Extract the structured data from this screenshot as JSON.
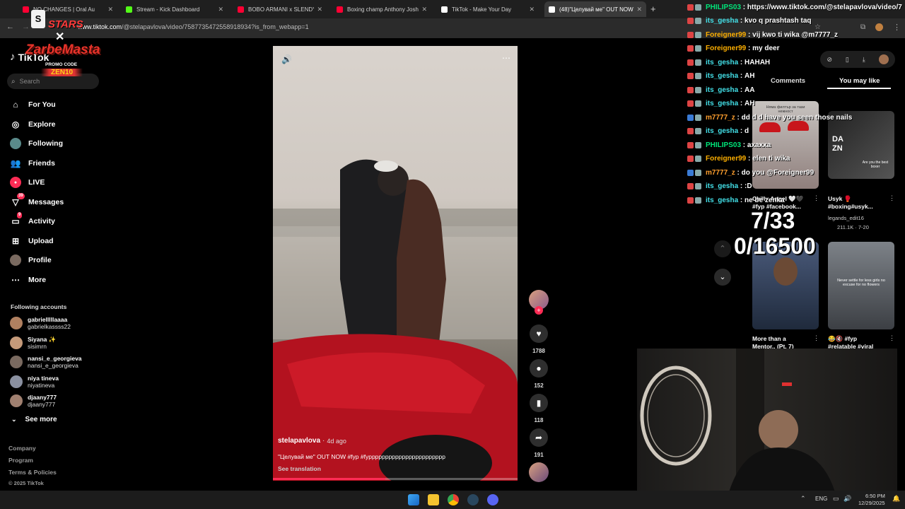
{
  "browser": {
    "tabs": [
      {
        "label": "NO CHANGES | Oral Au",
        "icon_color": "#ff0033",
        "active": false
      },
      {
        "label": "Stream - Kick Dashboard",
        "icon_color": "#53fc18",
        "active": false
      },
      {
        "label": "BOBO ARMANI x SLENDY x PAN",
        "icon_color": "#ff0033",
        "active": false
      },
      {
        "label": "Boxing champ Anthony Joshua",
        "icon_color": "#ff0033",
        "active": false
      },
      {
        "label": "TikTok - Make Your Day",
        "icon_color": "#ffffff",
        "active": false
      },
      {
        "label": "(48)\"Целувай ме\" OUT NOW",
        "icon_color": "#ffffff",
        "active": true
      }
    ],
    "new_tab_icon": "plus-icon",
    "url_host": "www.tiktok.com",
    "url_path": "/@stelapavlova/video/7587735472558918934?is_from_webapp=1"
  },
  "overlay": {
    "brand_top": "STARS",
    "brand_main": "ZarbeMasta",
    "promo_label": "PROMO CODE",
    "promo_code": "ZEN10",
    "counter_top": "7/33",
    "counter_bottom": "0/16500"
  },
  "tiktok": {
    "logo": "TikTok",
    "search_placeholder": "Search",
    "nav": [
      {
        "label": "For You",
        "icon": "home-icon",
        "badge": ""
      },
      {
        "label": "Explore",
        "icon": "compass-icon",
        "badge": ""
      },
      {
        "label": "Following",
        "icon": "following-avatar-icon",
        "badge": ""
      },
      {
        "label": "Friends",
        "icon": "friends-icon",
        "badge": ""
      },
      {
        "label": "LIVE",
        "icon": "live-icon",
        "badge": ""
      },
      {
        "label": "Messages",
        "icon": "messages-icon",
        "badge": "39"
      },
      {
        "label": "Activity",
        "icon": "activity-icon",
        "badge": "9"
      },
      {
        "label": "Upload",
        "icon": "upload-icon",
        "badge": ""
      },
      {
        "label": "Profile",
        "icon": "profile-avatar-icon",
        "badge": ""
      },
      {
        "label": "More",
        "icon": "more-dots-icon",
        "badge": ""
      }
    ],
    "following_header": "Following accounts",
    "accounts": [
      {
        "name": "gabrielllllaaaa",
        "handle": "gabrielkassss22",
        "color": "#b08060"
      },
      {
        "name": "Siyana ✨",
        "handle": "sisimrn",
        "color": "#c59a7a"
      },
      {
        "name": "nansi_e_georgieva",
        "handle": "nansi_e_georgieva",
        "color": "#7a6a60"
      },
      {
        "name": "niya tineva",
        "handle": "niyatineva",
        "color": "#8a90a0"
      },
      {
        "name": "djaany777",
        "handle": "djaany777",
        "color": "#a08070"
      }
    ],
    "see_more": "See more",
    "footer": [
      "Company",
      "Program",
      "Terms & Policies",
      "© 2025 TikTok"
    ],
    "video": {
      "author": "stelapavlova",
      "age": "4d ago",
      "caption": "\"Целувай ме\" OUT NOW #fyp #fyppppppppppppppppppppppp",
      "see_translation": "See translation",
      "progress": 0.46
    },
    "actions": [
      {
        "icon": "heart-icon",
        "count": "1788"
      },
      {
        "icon": "comment-icon",
        "count": "152"
      },
      {
        "icon": "bookmark-icon",
        "count": "118"
      },
      {
        "icon": "share-icon",
        "count": "191"
      }
    ],
    "panel_tabs": [
      "Comments",
      "You may like"
    ],
    "suggested": [
      {
        "caption": "Chilly Angel 🤍🖤 #fyp #facebook...",
        "author": "",
        "stats": ""
      },
      {
        "caption": "Usyk 🥊 #boxing#usyk...",
        "author": "legands_edit16",
        "stats": "211.1K · 7-20"
      },
      {
        "caption": "More than a Mentor.. (Pt. 7)",
        "author": "",
        "stats": ""
      },
      {
        "caption": "😂🔇 #fyp #relatable #viral",
        "author": "",
        "stats": ""
      }
    ],
    "thumb_texts": [
      "Няма филтър за тази нежност",
      "DA ZN",
      "Are you the best boxer",
      "Never settle for less girls no excuse for no flowers"
    ]
  },
  "chat": [
    {
      "user": "PHILIPS03",
      "user_color": "#00e67a",
      "message": "https://www.tiktok.com/@stelapavlova/video/7"
    },
    {
      "user": "its_gesha",
      "user_color": "#43e0e8",
      "message": "kvo q prashtash taq"
    },
    {
      "user": "Foreigner99",
      "user_color": "#ffb000",
      "message": "vij kwo ti wika @m7777_z"
    },
    {
      "user": "Foreigner99",
      "user_color": "#ffb000",
      "message": "my deer"
    },
    {
      "user": "its_gesha",
      "user_color": "#43e0e8",
      "message": "HAHAH"
    },
    {
      "user": "its_gesha",
      "user_color": "#43e0e8",
      "message": "AH"
    },
    {
      "user": "its_gesha",
      "user_color": "#43e0e8",
      "message": "AA"
    },
    {
      "user": "its_gesha",
      "user_color": "#43e0e8",
      "message": "AH"
    },
    {
      "user": "m7777_z",
      "user_color": "#ff9f2e",
      "message": "dd d d have you seen those nails"
    },
    {
      "user": "its_gesha",
      "user_color": "#43e0e8",
      "message": "d"
    },
    {
      "user": "PHILIPS03",
      "user_color": "#00e67a",
      "message": "axaxxa"
    },
    {
      "user": "Foreigner99",
      "user_color": "#ffb000",
      "message": "elen ti wika"
    },
    {
      "user": "m7777_z",
      "user_color": "#ff9f2e",
      "message": "do you @Foreigner99"
    },
    {
      "user": "its_gesha",
      "user_color": "#43e0e8",
      "message": ":D"
    },
    {
      "user": "its_gesha",
      "user_color": "#43e0e8",
      "message": "ne be zenka"
    }
  ],
  "taskbar": {
    "lang": "ENG",
    "time": "6:50 PM",
    "date": "12/29/2025",
    "apps": [
      "windows-start-icon",
      "file-explorer-icon",
      "chrome-icon",
      "steam-icon",
      "discord-icon"
    ]
  },
  "colors": {
    "accent": "#fe2c55",
    "chrome_bg": "#1f1f1f"
  }
}
